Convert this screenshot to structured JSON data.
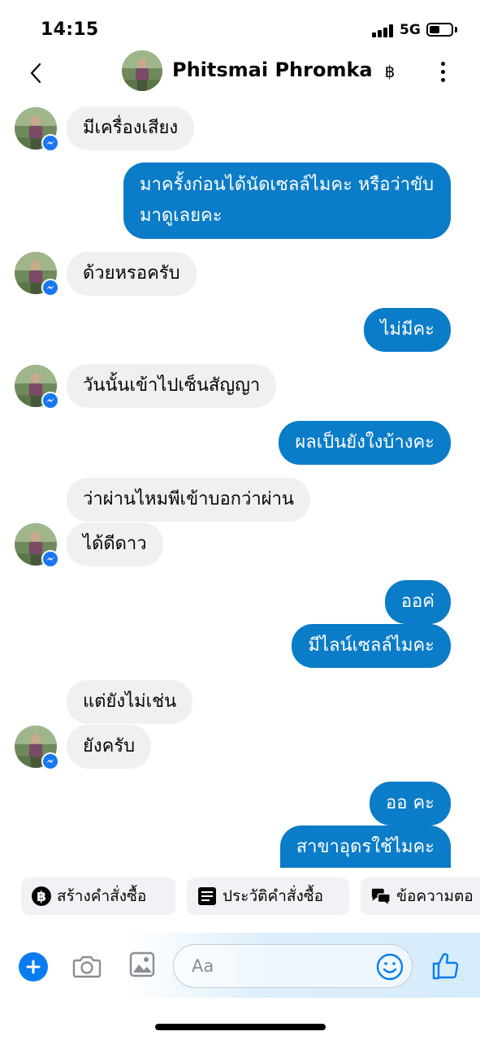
{
  "status": {
    "time": "14:15",
    "network": "5G"
  },
  "header": {
    "name": "Phitsmai Phromka",
    "currency_symbol": "฿"
  },
  "messages": [
    {
      "from": "them",
      "text": "มีเครื่องเสียง"
    },
    {
      "from": "me",
      "text": "มาครั้งก่อนได้นัดเซลล์ไมคะ หรือว่าขับมาดูเลยคะ"
    },
    {
      "from": "them",
      "text": "ด้วยหรอครับ"
    },
    {
      "from": "me",
      "text": "ไม่มีคะ"
    },
    {
      "from": "them",
      "text": "วันนั้นเข้าไปเซ็นสัญญา"
    },
    {
      "from": "me",
      "text": "ผลเป็นยังใงบ้างคะ"
    },
    {
      "from": "them",
      "text": "ว่าผ่านไหมพีเข้าบอกว่าผ่าน"
    },
    {
      "from": "them",
      "text": "ได้ดีดาว"
    },
    {
      "from": "me",
      "text": "ออค่"
    },
    {
      "from": "me",
      "text": "มีไลน์เซลล์ไมคะ"
    },
    {
      "from": "them",
      "text": "แต่ยังไม่เช่น"
    },
    {
      "from": "them",
      "text": "ยังครับ"
    },
    {
      "from": "me",
      "text": "ออ คะ"
    },
    {
      "from": "me",
      "text": "สาขาอุดรใช้ไมคะ"
    }
  ],
  "quick_actions": [
    {
      "label": "สร้างคำสั่งซื้อ",
      "icon": "baht-circle-icon"
    },
    {
      "label": "ประวัติคำสั่งซื้อ",
      "icon": "list-icon"
    },
    {
      "label": "ข้อความตอ",
      "icon": "chat-bubbles-icon"
    }
  ],
  "composer": {
    "placeholder": "Aa"
  },
  "colors": {
    "outgoing": "#0a7cc8",
    "incoming": "#f0f0f0",
    "accent": "#0a7cf2"
  }
}
